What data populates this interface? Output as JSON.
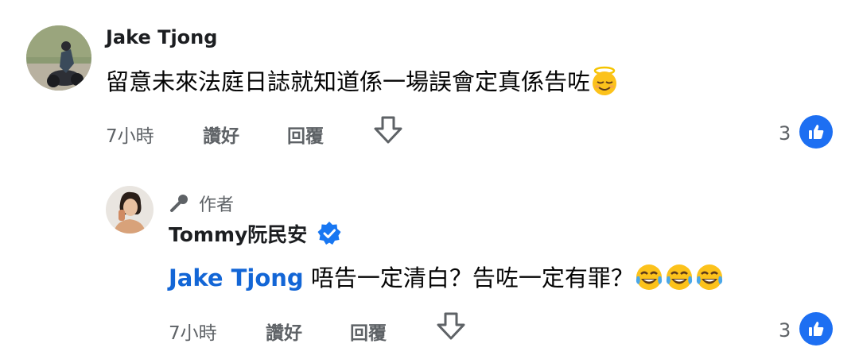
{
  "comment": {
    "author": "Jake Tjong",
    "text": "留意未來法庭日誌就知道係一場誤會定真係告咗",
    "emoji": "smiling-face-with-halo",
    "time": "7小時",
    "like_label": "讚好",
    "reply_label": "回覆",
    "like_count": "3"
  },
  "reply": {
    "author_badge": "作者",
    "author": "Tommy阮民安",
    "mention": "Jake Tjong",
    "text": " 唔告一定清白？告咗一定有罪？",
    "emojis": [
      "face-with-tears-of-joy",
      "face-with-tears-of-joy",
      "face-with-tears-of-joy"
    ],
    "time": "7小時",
    "like_label": "讚好",
    "reply_label": "回覆",
    "like_count": "3"
  },
  "colors": {
    "accent": "#1d6ff2",
    "mention": "#1366d6",
    "meta": "#5e6266"
  }
}
